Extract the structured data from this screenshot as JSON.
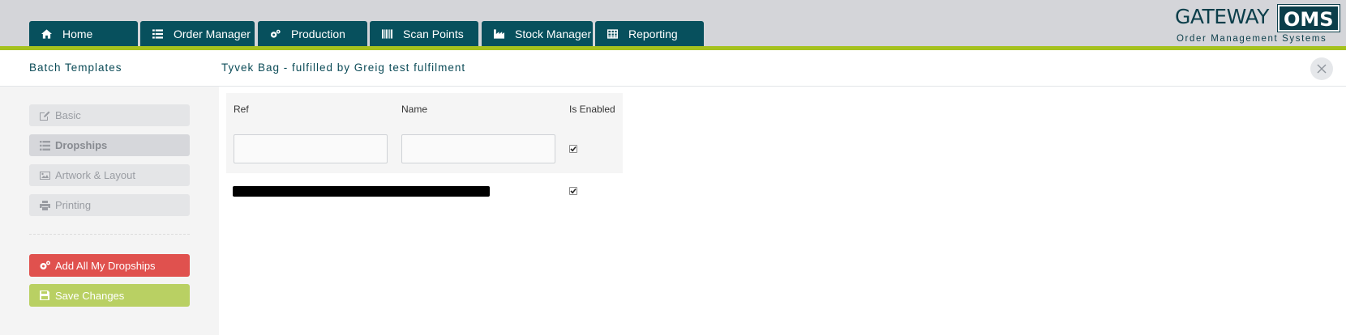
{
  "nav": {
    "tabs": [
      {
        "label": "Home",
        "icon": "home-icon"
      },
      {
        "label": "Order Manager",
        "icon": "list-icon"
      },
      {
        "label": "Production",
        "icon": "cogs-icon"
      },
      {
        "label": "Scan Points",
        "icon": "barcode-icon"
      },
      {
        "label": "Stock Manager",
        "icon": "industry-icon"
      },
      {
        "label": "Reporting",
        "icon": "table-icon"
      }
    ],
    "accent_color": "#a5c21e",
    "tab_color": "#07505d"
  },
  "logo": {
    "word": "GATEWAY",
    "box": "OMS",
    "tagline": "Order Management Systems"
  },
  "header": {
    "section": "Batch Templates",
    "title": "Tyvek Bag - fulfilled by Greig test fulfilment",
    "close_icon": "close-icon"
  },
  "sidebar": {
    "items": [
      {
        "label": "Basic",
        "icon": "edit-icon",
        "active": false
      },
      {
        "label": "Dropships",
        "icon": "list-icon",
        "active": true
      },
      {
        "label": "Artwork & Layout",
        "icon": "image-icon",
        "active": false
      },
      {
        "label": "Printing",
        "icon": "print-icon",
        "active": false
      }
    ],
    "add_button": "Add All My Dropships",
    "save_button": "Save Changes",
    "add_button_color": "#e0514e",
    "save_button_color": "#b9d063"
  },
  "table": {
    "columns": [
      "Ref",
      "Name",
      "Is Enabled"
    ],
    "new_row": {
      "ref": "",
      "name": "",
      "enabled": true
    },
    "rows": [
      {
        "enabled": true
      }
    ]
  }
}
